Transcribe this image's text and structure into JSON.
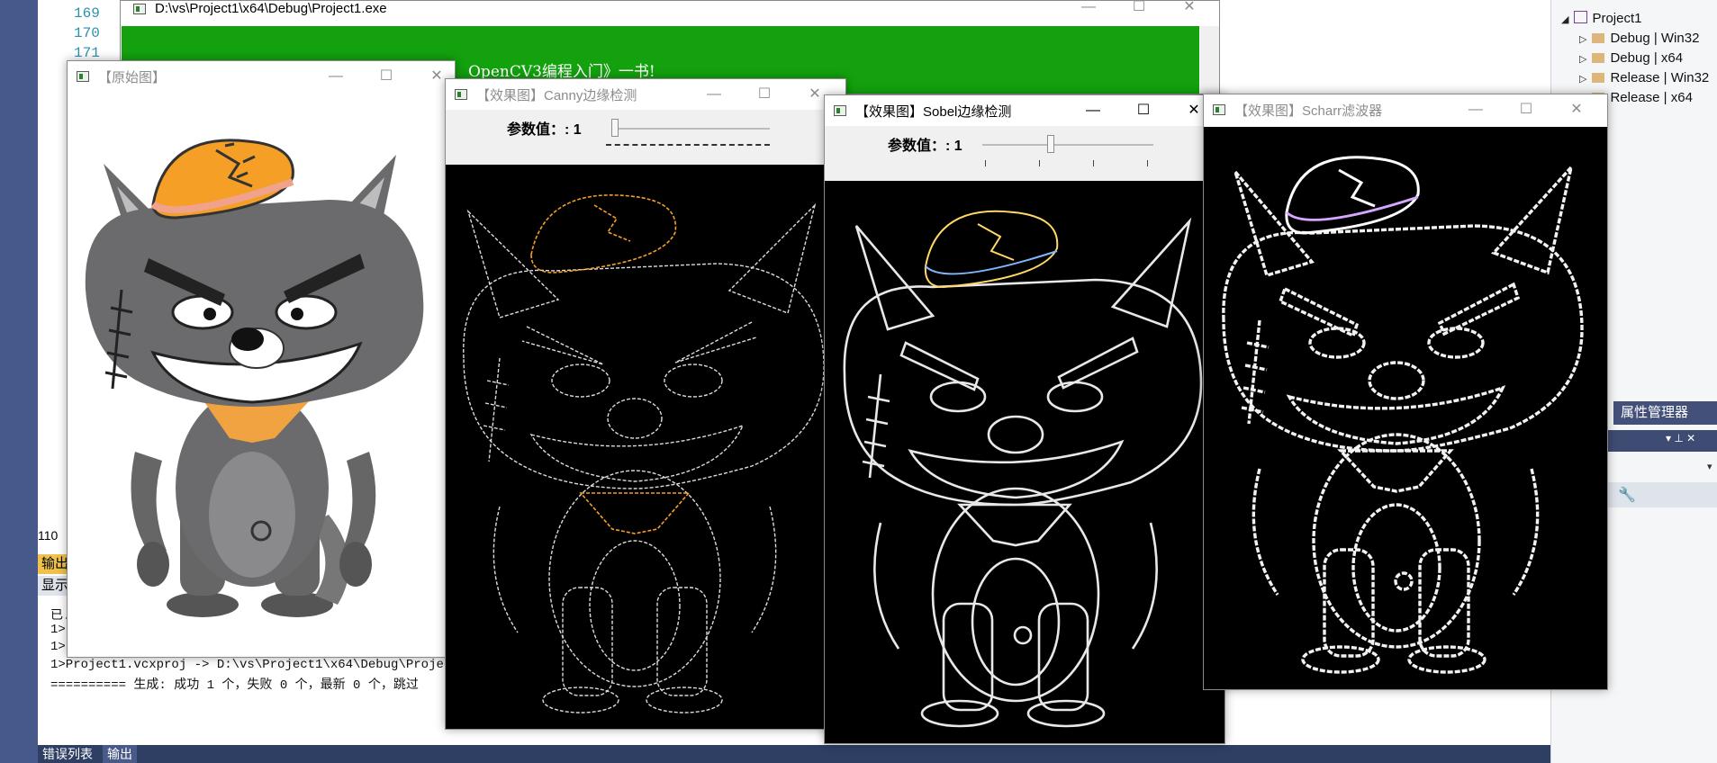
{
  "ide": {
    "line_numbers": [
      "169",
      "170",
      "171"
    ],
    "line_label": "110",
    "solution_tree": [
      {
        "label": "Project1",
        "expanded": true
      },
      {
        "label": "Debug | Win32"
      },
      {
        "label": "Debug | x64"
      },
      {
        "label": "Release | Win32"
      },
      {
        "label": "Release | x64"
      }
    ],
    "property_tab": "属性管理器",
    "output": {
      "title": "输出",
      "show_label": "显示",
      "lines": [
        "已.",
        "1>",
        "1>",
        "1>Project1.vcxproj -> D:\\vs\\Project1\\x64\\Debug\\Project1",
        "========== 生成: 成功 1 个，失败 0 个，最新 0 个，跳过"
      ]
    },
    "bottom_tabs": [
      "错误列表",
      "输出"
    ]
  },
  "console": {
    "title": "D:\\vs\\Project1\\x64\\Debug\\Project1.exe",
    "text": "OpenCV3编程入门》一书!"
  },
  "windows": {
    "original": {
      "title": "【原始图】"
    },
    "canny": {
      "title": "【效果图】Canny边缘检测",
      "param_label": "参数值：: 1",
      "param_fraction": 0.0
    },
    "sobel": {
      "title": "【效果图】Sobel边缘检测",
      "param_label": "参数值：: 1",
      "param_fraction": 0.38
    },
    "scharr": {
      "title": "【效果图】Scharr滤波器"
    }
  },
  "window_controls": {
    "minimize": "—",
    "maximize": "☐",
    "close": "✕"
  },
  "colors": {
    "console_green": "#13a10e",
    "wolf_gray": "#6b6b6d",
    "hat_orange": "#f59f27",
    "scarf_orange": "#f2a341"
  }
}
